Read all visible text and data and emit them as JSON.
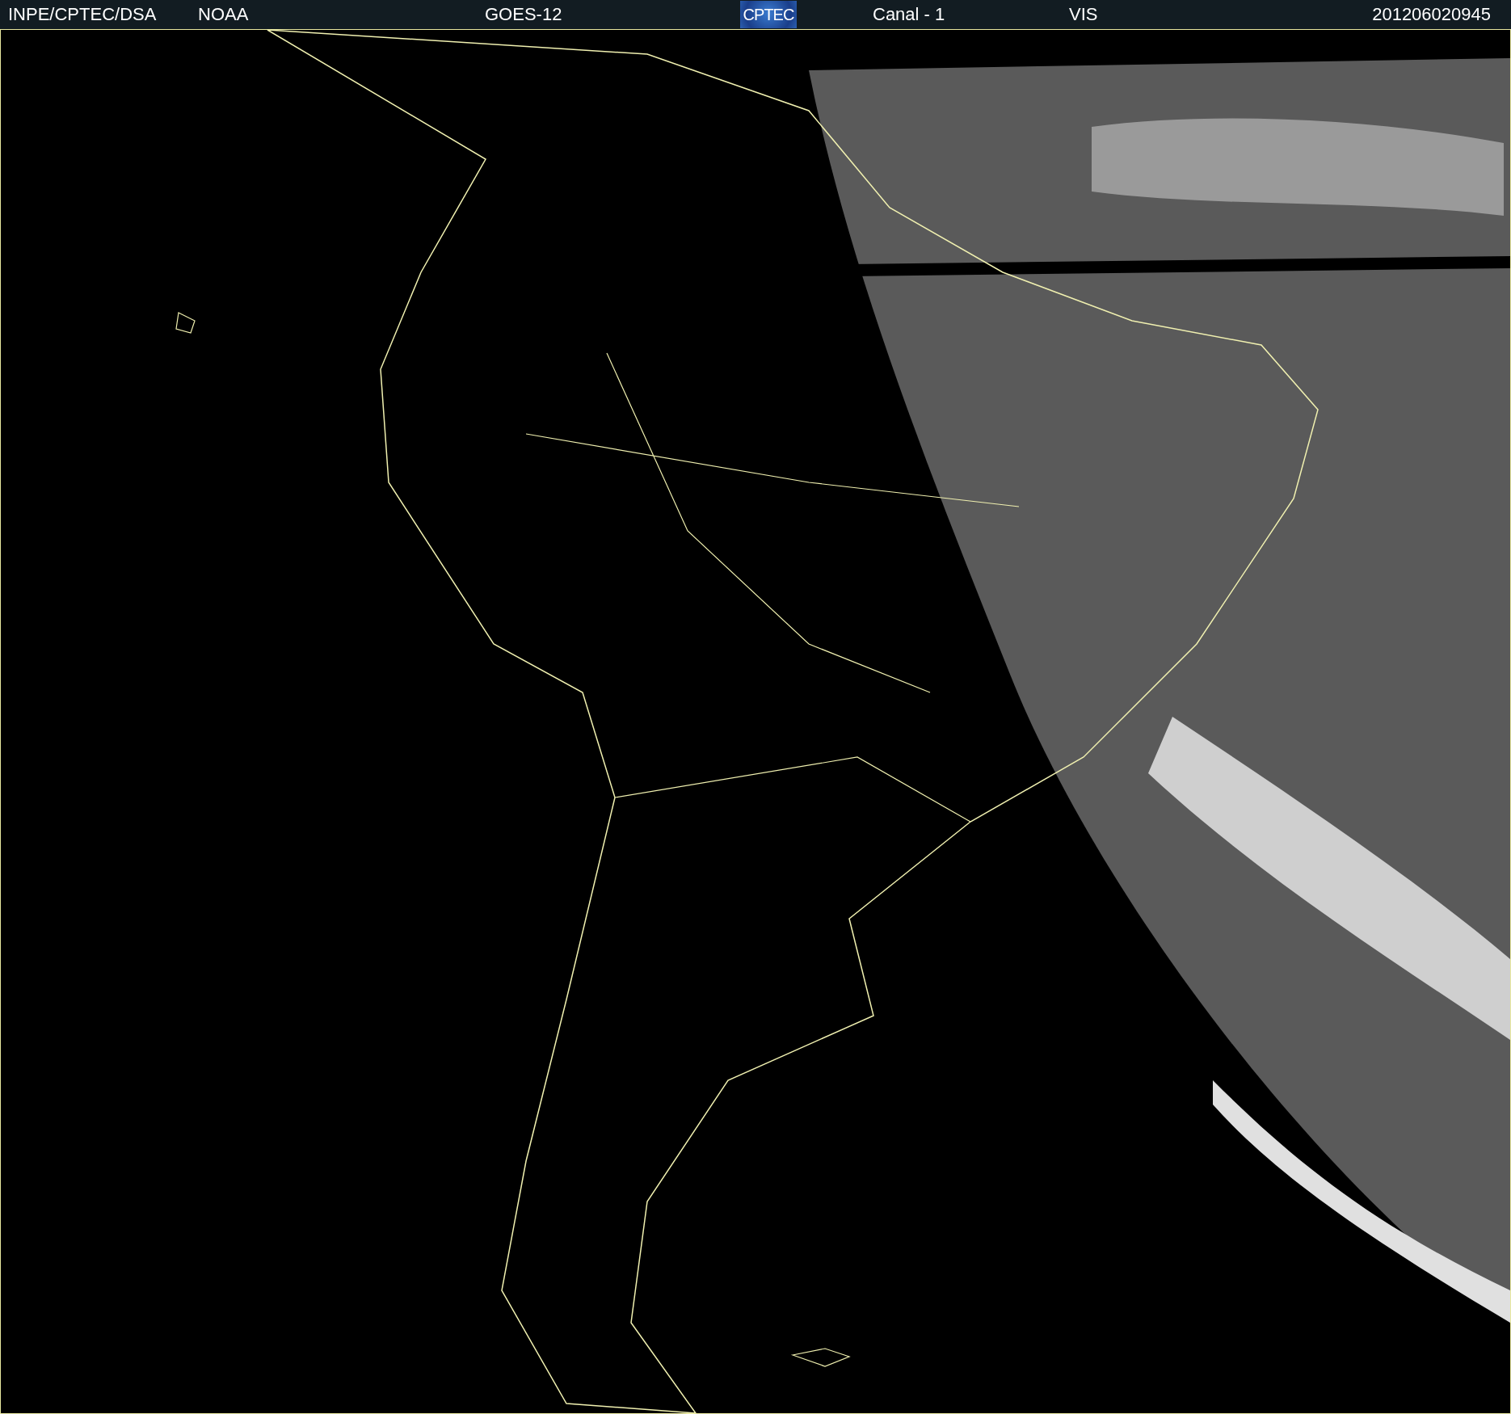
{
  "header": {
    "source": "INPE/CPTEC/DSA",
    "agency": "NOAA",
    "satellite": "GOES-12",
    "logo": "CPTEC",
    "channel": "Canal - 1",
    "band": "VIS",
    "timestamp": "201206020945"
  }
}
